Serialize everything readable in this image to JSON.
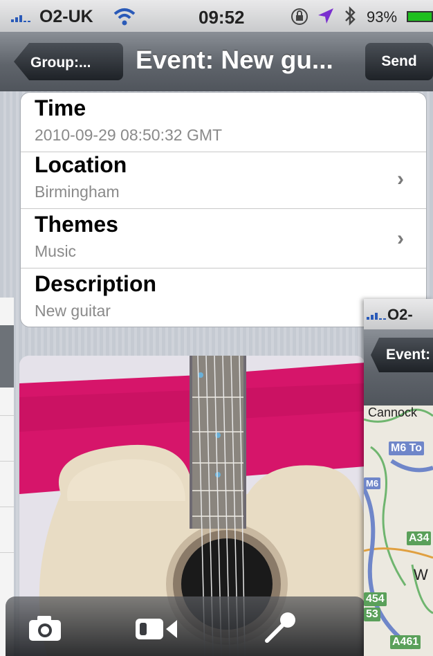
{
  "status": {
    "carrier": "O2-UK",
    "time": "09:52",
    "battery": "93%"
  },
  "nav": {
    "back_label": "Group:...",
    "title": "Event: New gu...",
    "send_label": "Send"
  },
  "rows": [
    {
      "label": "Time",
      "value": "2010-09-29 08:50:32 GMT"
    },
    {
      "label": "Location",
      "value": "Birmingham"
    },
    {
      "label": "Themes",
      "value": "Music"
    },
    {
      "label": "Description",
      "value": "New guitar"
    }
  ],
  "toolbar": {
    "icons": [
      "camera-icon",
      "video-camera-icon",
      "microphone-icon"
    ]
  },
  "map_card": {
    "carrier": "O2-",
    "back_label": "Event:",
    "places": [
      "Cannock",
      "W"
    ],
    "roads": [
      "M6 To",
      "M6",
      "A34",
      "454",
      "53",
      "A461"
    ]
  },
  "colors": {
    "accent_green": "#1fbf1f",
    "nav_dark": "#1e2227",
    "road_green": "#5aa05a",
    "road_blue": "#6f86c9"
  }
}
